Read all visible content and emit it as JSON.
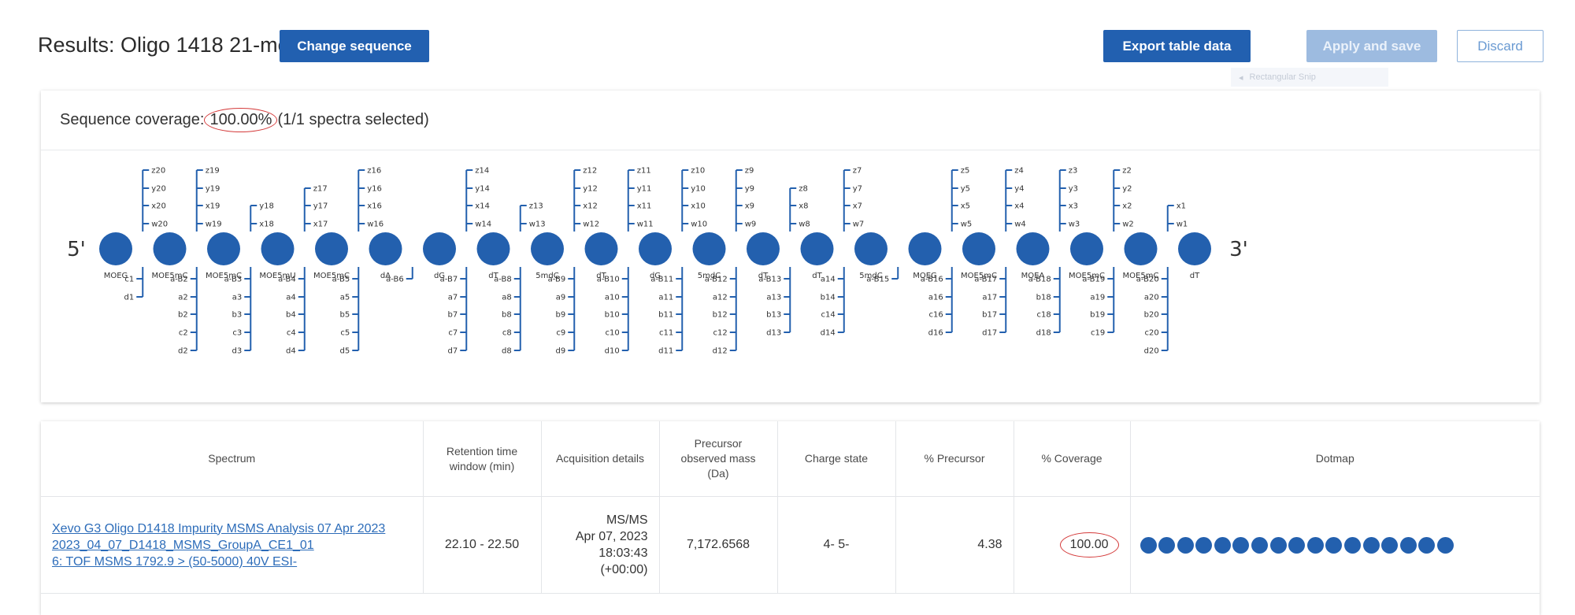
{
  "header": {
    "title": "Results: Oligo 1418 21-mer",
    "change_sequence": "Change sequence",
    "export": "Export table data",
    "apply": "Apply and save",
    "discard": "Discard",
    "snip_tooltip": "Rectangular Snip"
  },
  "coverage": {
    "label": "Sequence coverage:",
    "percent": "100.00%",
    "spectra": "(1/1 spectra selected)",
    "five_prime": "5'",
    "three_prime": "3'",
    "residues": [
      "MOEG",
      "MOE5mC",
      "MOE5mC",
      "MOE5mU",
      "MOE5mC",
      "dA",
      "dG",
      "dT",
      "5mdC",
      "dT",
      "dG",
      "5mdC",
      "dT",
      "dT",
      "5mdC",
      "MOEG",
      "MOE5mC",
      "MOEA",
      "MOE5mC",
      "MOE5mC",
      "dT"
    ],
    "top_fragments": [
      [
        "z20",
        "y20",
        "x20",
        "w20"
      ],
      [
        "z19",
        "y19",
        "x19",
        "w19"
      ],
      [
        "y18",
        "x18"
      ],
      [
        "z17",
        "y17",
        "x17"
      ],
      [
        "z16",
        "y16",
        "x16",
        "w16"
      ],
      [],
      [
        "z14",
        "y14",
        "x14",
        "w14"
      ],
      [
        "z13",
        "w13"
      ],
      [
        "z12",
        "y12",
        "x12",
        "w12"
      ],
      [
        "z11",
        "y11",
        "x11",
        "w11"
      ],
      [
        "z10",
        "y10",
        "x10",
        "w10"
      ],
      [
        "z9",
        "y9",
        "x9",
        "w9"
      ],
      [
        "z8",
        "x8",
        "w8"
      ],
      [
        "z7",
        "y7",
        "x7",
        "w7"
      ],
      [],
      [
        "z5",
        "y5",
        "x5",
        "w5"
      ],
      [
        "z4",
        "y4",
        "x4",
        "w4"
      ],
      [
        "z3",
        "y3",
        "x3",
        "w3"
      ],
      [
        "z2",
        "y2",
        "x2",
        "w2"
      ],
      [
        "x1",
        "w1"
      ]
    ],
    "bottom_fragments": [
      [
        "c1",
        "d1"
      ],
      [
        "a-B2",
        "a2",
        "b2",
        "c2",
        "d2"
      ],
      [
        "a-B3",
        "a3",
        "b3",
        "c3",
        "d3"
      ],
      [
        "a-B4",
        "a4",
        "b4",
        "c4",
        "d4"
      ],
      [
        "a-B5",
        "a5",
        "b5",
        "c5",
        "d5"
      ],
      [
        "a-B6"
      ],
      [
        "a-B7",
        "a7",
        "b7",
        "c7",
        "d7"
      ],
      [
        "a-B8",
        "a8",
        "b8",
        "c8",
        "d8"
      ],
      [
        "a-B9",
        "a9",
        "b9",
        "c9",
        "d9"
      ],
      [
        "a-B10",
        "a10",
        "b10",
        "c10",
        "d10"
      ],
      [
        "a-B11",
        "a11",
        "b11",
        "c11",
        "d11"
      ],
      [
        "a-B12",
        "a12",
        "b12",
        "c12",
        "d12"
      ],
      [
        "a-B13",
        "a13",
        "b13",
        "d13"
      ],
      [
        "a14",
        "b14",
        "c14",
        "d14"
      ],
      [
        "a-B15"
      ],
      [
        "a-B16",
        "a16",
        "c16",
        "d16"
      ],
      [
        "a-B17",
        "a17",
        "b17",
        "d17"
      ],
      [
        "a-B18",
        "b18",
        "c18",
        "d18"
      ],
      [
        "a-B19",
        "a19",
        "b19",
        "c19"
      ],
      [
        "a-B20",
        "a20",
        "b20",
        "c20",
        "d20"
      ]
    ]
  },
  "table": {
    "headers": {
      "spectrum": "Spectrum",
      "retention": "Retention time window (min)",
      "acquisition": "Acquisition details",
      "precursor_mass": "Precursor observed mass (Da)",
      "charge": "Charge state",
      "pct_precursor": "% Precursor",
      "pct_coverage": "% Coverage",
      "dotmap": "Dotmap"
    },
    "row": {
      "spectrum_line1": "Xevo G3 Oligo D1418 Impurity MSMS Analysis 07 Apr 2023",
      "spectrum_line2": "2023_04_07_D1418_MSMS_GroupA_CE1_01",
      "spectrum_line3": "6: TOF MSMS 1792.9 > (50-5000) 40V ESI-",
      "retention": "22.10 - 22.50",
      "acq_type": "MS/MS",
      "acq_date": "Apr 07, 2023",
      "acq_time": "18:03:43",
      "acq_tz": "(+00:00)",
      "precursor_mass": "7,172.6568",
      "charge": "4- 5-",
      "pct_precursor": "4.38",
      "pct_coverage": "100.00",
      "dot_count": 17
    }
  },
  "colors": {
    "primary": "#2260b0",
    "disabled": "#9dbbe0",
    "residue": "#2360ae",
    "highlight": "#d43a3a",
    "link": "#2c6cb9"
  }
}
